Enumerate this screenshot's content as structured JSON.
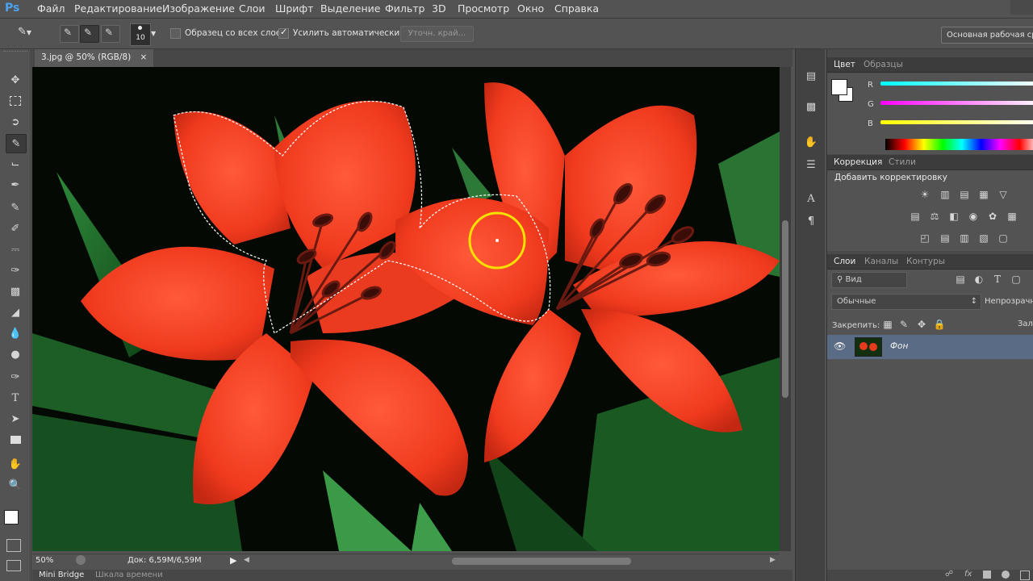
{
  "app": {
    "logo": "Ps"
  },
  "menu": [
    "Файл",
    "Редактирование",
    "Изображение",
    "Слои",
    "Шрифт",
    "Выделение",
    "Фильтр",
    "3D",
    "Просмотр",
    "Окно",
    "Справка"
  ],
  "options": {
    "brush_size": "10",
    "sample_all_layers": "Образец со всех слоев",
    "auto_enhance": "Усилить автоматически",
    "refine_edge": "Уточн. край...",
    "workspace": "Основная рабочая сред"
  },
  "document": {
    "tab_title": "3.jpg @ 50% (RGB/8)",
    "close_glyph": "×",
    "zoom": "50%",
    "doc_size": "Док: 6,59M/6,59M"
  },
  "bottom_tabs": [
    "Mini Bridge",
    "Шкала времени"
  ],
  "color_panel": {
    "tabs": [
      "Цвет",
      "Образцы"
    ],
    "channels": [
      "R",
      "G",
      "B"
    ]
  },
  "adjust_panel": {
    "tabs": [
      "Коррекция",
      "Стили"
    ],
    "heading": "Добавить корректировку"
  },
  "layers_panel": {
    "tabs": [
      "Слои",
      "Каналы",
      "Контуры"
    ],
    "filter": "Вид",
    "blend_mode": "Обычные",
    "opacity_label": "Непрозрачн",
    "lock_label": "Закрепить:",
    "fill_label": "Зал",
    "layer_name": "Фон"
  },
  "icons": {
    "tools": [
      "move-icon",
      "marquee-icon",
      "lasso-icon",
      "quick-selection-icon",
      "crop-icon",
      "eyedropper-icon",
      "healing-brush-icon",
      "brush-icon",
      "clone-stamp-icon",
      "history-brush-icon",
      "eraser-icon",
      "gradient-icon",
      "blur-icon",
      "dodge-icon",
      "pen-icon",
      "type-icon",
      "path-selection-icon",
      "rectangle-icon",
      "hand-icon",
      "zoom-icon"
    ],
    "strip": [
      "history-icon",
      "3d-icon",
      "actions-icon",
      "properties-icon",
      "character-icon",
      "paragraph-icon"
    ]
  },
  "colors": {
    "accent_selection": "#5a6b85",
    "panel_bg": "#535353",
    "brush_cursor": "#f5e000"
  }
}
